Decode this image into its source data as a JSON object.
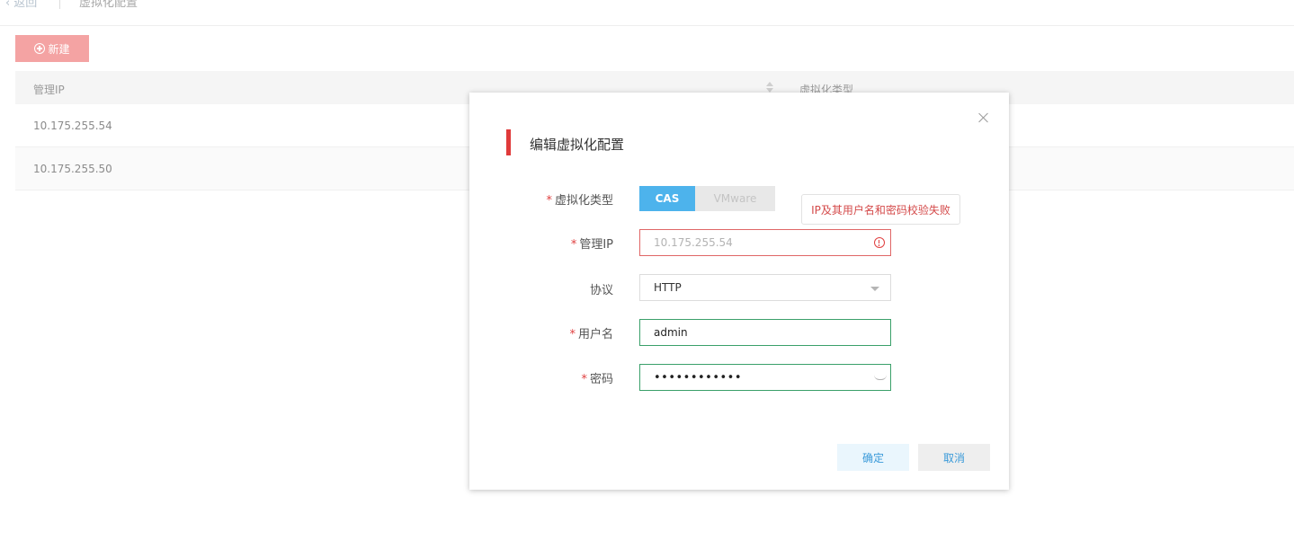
{
  "nav": {
    "back_label": "返回",
    "page_title": "虚拟化配置"
  },
  "toolbar": {
    "new_label": "新建"
  },
  "table": {
    "columns": [
      "管理IP",
      "虚拟化类型"
    ],
    "rows": [
      {
        "ip": "10.175.255.54"
      },
      {
        "ip": "10.175.255.50"
      }
    ]
  },
  "modal": {
    "title": "编辑虚拟化配置",
    "required_mark": "*",
    "virt_type": {
      "label": "虚拟化类型",
      "options": [
        "CAS",
        "VMware"
      ],
      "selected": "CAS"
    },
    "validation_tooltip": "IP及其用户名和密码校验失败",
    "mgmt_ip": {
      "label": "管理IP",
      "value": "10.175.255.54"
    },
    "protocol": {
      "label": "协议",
      "value": "HTTP"
    },
    "username": {
      "label": "用户名",
      "value": "admin"
    },
    "password": {
      "label": "密码",
      "masked_value": "••••••••••••"
    },
    "confirm_label": "确定",
    "cancel_label": "取消"
  },
  "colors": {
    "accent_red": "#e03a3a",
    "new_button": "#f4a3a3",
    "segment_active": "#4db3ec",
    "error_border": "#e06666",
    "success_border": "#3aa06a",
    "link_blue": "#3a9ad9"
  },
  "icons": [
    "chevron-left-icon",
    "plus-circle-icon",
    "sort-icon",
    "close-icon",
    "error-circle-icon",
    "caret-down-icon",
    "eye-closed-icon"
  ]
}
